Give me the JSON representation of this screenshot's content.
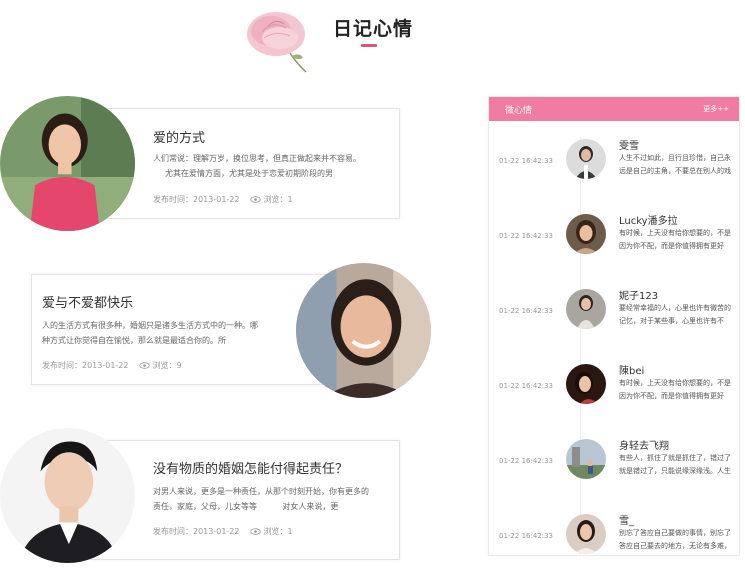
{
  "header": {
    "title": "日记心情"
  },
  "diaries": [
    {
      "title": "爱的方式",
      "text_lines": [
        "人们常说：理解万岁，换位思考，但真正做起来并不容易。",
        "尤其在爱情方面，尤其是处于恋爱初期阶段的男"
      ],
      "time_label": "发布时间：2013-01-22",
      "views_label": "浏览：1"
    },
    {
      "title": "爱与不爱都快乐",
      "text_lines": [
        "人的生活方式有很多种，婚姻只是诸多生活方式中的一种。哪",
        "种方式让你觉得自在愉悦，那么就是最适合你的。所"
      ],
      "time_label": "发布时间：2013-01-22",
      "views_label": "浏览：9"
    },
    {
      "title": "没有物质的婚姻怎能付得起责任？",
      "text_lines": [
        "对男人来说，更多是一种责任，从那个时刻开始，你有更多的",
        "责任，家庭，父母，儿女等等          对女人来说，更"
      ],
      "time_label": "发布时间：2013-01-22",
      "views_label": "浏览：1"
    }
  ],
  "sidebar": {
    "title": "微心情",
    "more": "更多++",
    "items": [
      {
        "time": "01-22 16:42:33",
        "name": "雯雪",
        "lines": [
          "人生不过如此，且行且珍惜，自己永",
          "远是自己的主角，不要总在别人的戏"
        ]
      },
      {
        "time": "01-22 16:42:33",
        "name": "Lucky潘多拉",
        "lines": [
          "有时候，上天没有给你想要的，不是",
          "因为你不配，而是你值得拥有更好"
        ]
      },
      {
        "time": "01-22 16:42:33",
        "name": "妮子123",
        "lines": [
          "要经常幸福的人，心里也许有微苦的",
          "记忆，对于某些事，心里也许有不"
        ]
      },
      {
        "time": "01-22 16:42:33",
        "name": "陳bei",
        "lines": [
          "有时候，上天没有给你想要的，不是",
          "因为你不配，而是你值得拥有更好"
        ]
      },
      {
        "time": "01-22 16:42:33",
        "name": "身轻去飞翔",
        "lines": [
          "有些人，抓住了就是抓住了，错过了",
          "就是错过了，只能说缘深缘浅。人生"
        ]
      },
      {
        "time": "01-22 16:42:33",
        "name": "雪_",
        "lines": [
          "别忘了答应自己要做的事情，别忘了",
          "答应自己要去的地方，无论有多难，"
        ]
      }
    ]
  },
  "colors": {
    "accent": "#e0527f",
    "sidebar_header": "#f07ca3"
  }
}
